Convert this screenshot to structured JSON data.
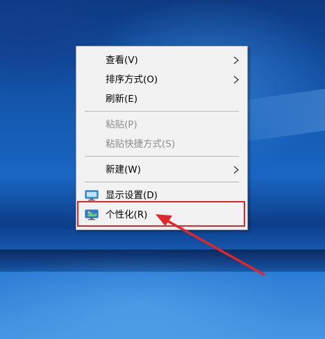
{
  "context_menu": {
    "items": [
      {
        "label": "查看(V)",
        "submenu": true,
        "enabled": true
      },
      {
        "label": "排序方式(O)",
        "submenu": true,
        "enabled": true
      },
      {
        "label": "刷新(E)",
        "submenu": false,
        "enabled": true
      },
      {
        "label": "粘贴(P)",
        "submenu": false,
        "enabled": false
      },
      {
        "label": "粘贴快捷方式(S)",
        "submenu": false,
        "enabled": false
      },
      {
        "label": "新建(W)",
        "submenu": true,
        "enabled": true
      },
      {
        "label": "显示设置(D)",
        "icon": "display-settings-icon",
        "enabled": true
      },
      {
        "label": "个性化(R)",
        "icon": "personalize-icon",
        "enabled": true,
        "annotated": true
      }
    ]
  },
  "annotation": {
    "highlight_color": "#e0262a",
    "target": "个性化(R)"
  },
  "colors": {
    "menu_background": "#f2f2f2",
    "disabled_text": "#8d8d8d",
    "desktop_blue": "#1357ad"
  }
}
